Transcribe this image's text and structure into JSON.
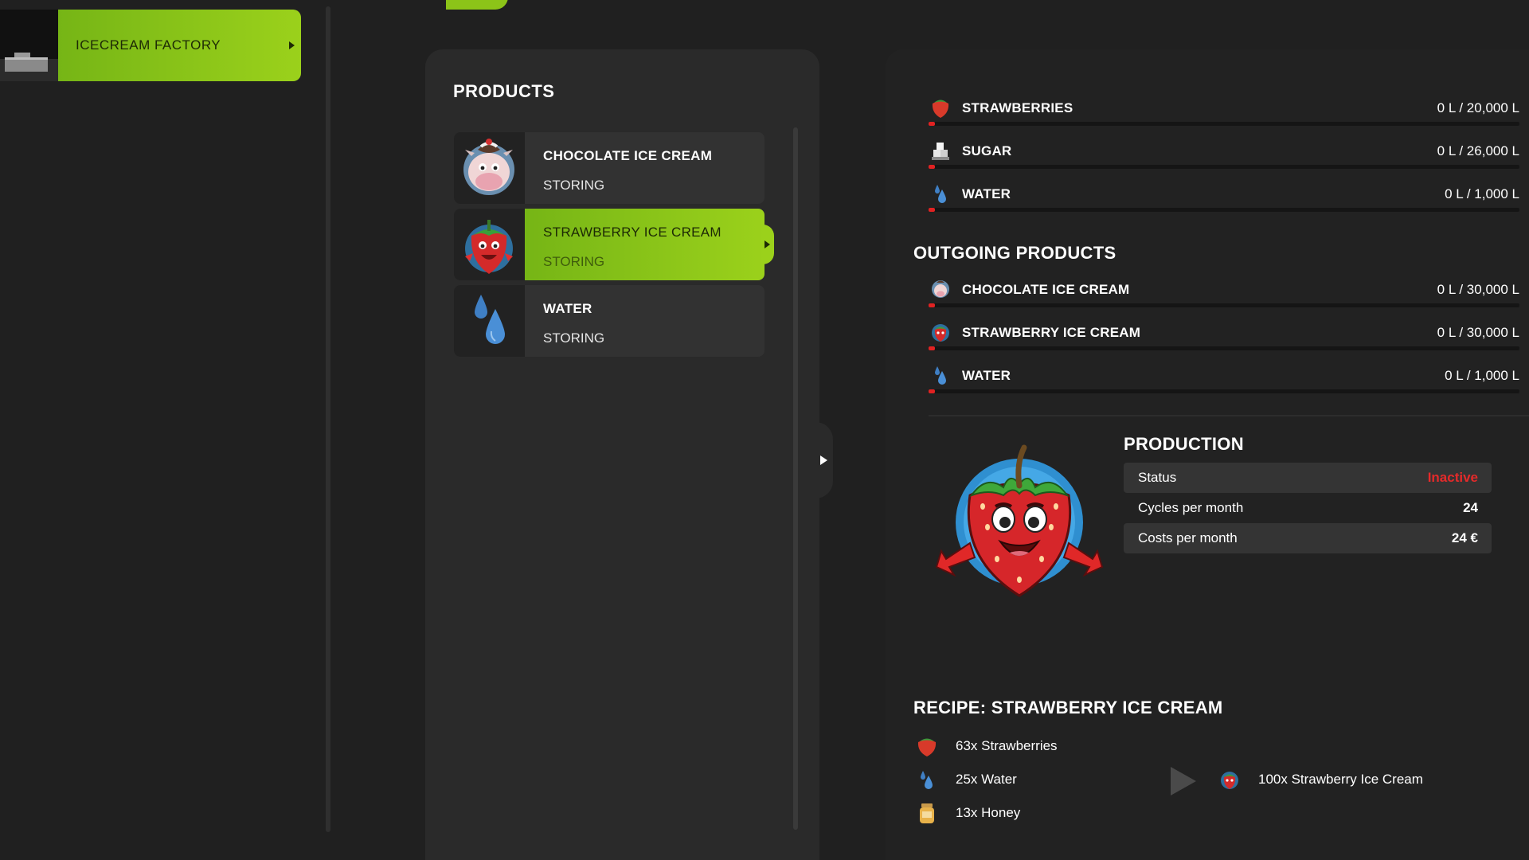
{
  "sidebar": {
    "factory_label": "ICECREAM FACTORY"
  },
  "products_panel": {
    "title": "PRODUCTS",
    "items": [
      {
        "name": "CHOCOLATE ICE CREAM",
        "state": "STORING",
        "icon": "cow-icecream-icon"
      },
      {
        "name": "STRAWBERRY ICE CREAM",
        "state": "STORING",
        "icon": "strawberry-mascot-icon"
      },
      {
        "name": "WATER",
        "state": "STORING",
        "icon": "water-drops-icon"
      }
    ]
  },
  "incoming": [
    {
      "name": "STRAWBERRIES",
      "amount": "0 L / 20,000 L",
      "icon": "strawberry-icon",
      "fill": 0
    },
    {
      "name": "SUGAR",
      "amount": "0 L / 26,000 L",
      "icon": "sugar-icon",
      "fill": 0
    },
    {
      "name": "WATER",
      "amount": "0 L / 1,000 L",
      "icon": "water-icon",
      "fill": 0
    }
  ],
  "outgoing": {
    "title": "OUTGOING PRODUCTS",
    "items": [
      {
        "name": "CHOCOLATE ICE CREAM",
        "amount": "0 L / 30,000 L",
        "icon": "cow-icecream-icon",
        "fill": 0
      },
      {
        "name": "STRAWBERRY ICE CREAM",
        "amount": "0 L / 30,000 L",
        "icon": "strawberry-mascot-icon",
        "fill": 0
      },
      {
        "name": "WATER",
        "amount": "0 L / 1,000 L",
        "icon": "water-icon",
        "fill": 0
      }
    ]
  },
  "production": {
    "title": "PRODUCTION",
    "status_label": "Status",
    "status_value": "Inactive",
    "cycles_label": "Cycles per month",
    "cycles_value": "24",
    "costs_label": "Costs per month",
    "costs_value": "24 €"
  },
  "recipe": {
    "title": "RECIPE: STRAWBERRY ICE CREAM",
    "inputs": [
      {
        "text": "63x Strawberries",
        "icon": "strawberry-icon"
      },
      {
        "text": "25x Water",
        "icon": "water-icon"
      },
      {
        "text": "13x Honey",
        "icon": "honey-jar-icon"
      }
    ],
    "output": {
      "text": "100x Strawberry Ice Cream",
      "icon": "strawberry-mascot-icon"
    }
  },
  "colors": {
    "accent_green": "#8cc418",
    "status_red": "#e52a2a",
    "panel_bg": "#2a2a2a"
  }
}
